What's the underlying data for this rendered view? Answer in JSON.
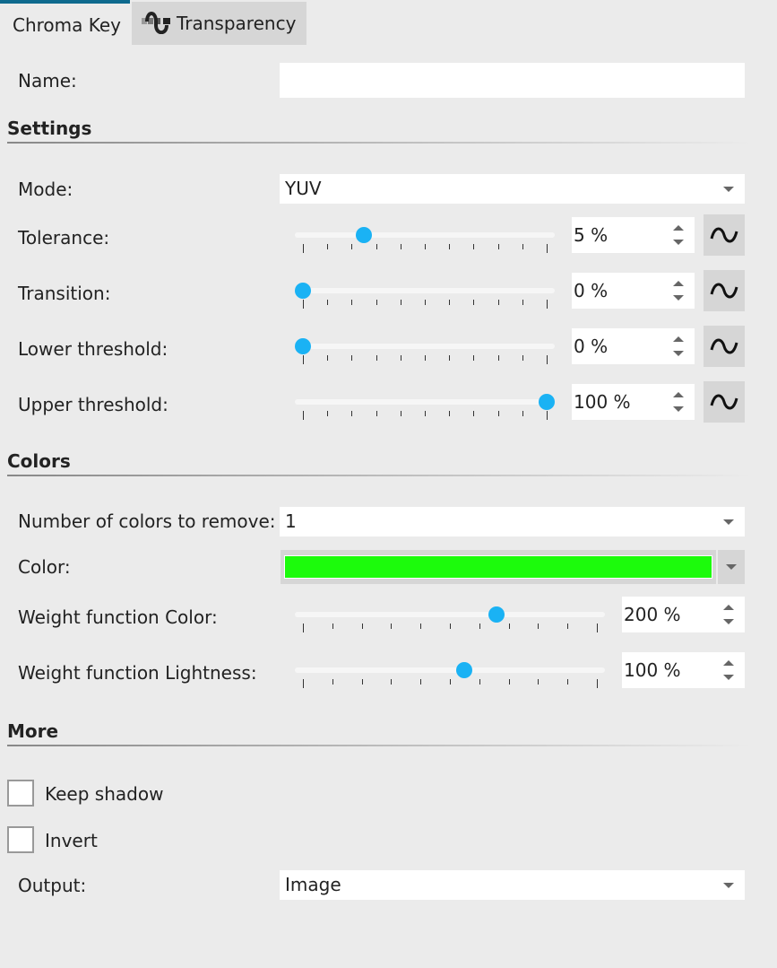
{
  "tabs": [
    {
      "label": "Chroma Key",
      "active": true
    },
    {
      "label": "Transparency",
      "active": false,
      "icon": "transparency-icon"
    }
  ],
  "name": {
    "label": "Name:",
    "value": ""
  },
  "sections": {
    "settings": "Settings",
    "colors": "Colors",
    "more": "More"
  },
  "settings": {
    "mode": {
      "label": "Mode:",
      "value": "YUV"
    },
    "sliders": [
      {
        "label": "Tolerance:",
        "display": "5 %",
        "fraction": 0.25
      },
      {
        "label": "Transition:",
        "display": "0 %",
        "fraction": 0.0
      },
      {
        "label": "Lower threshold:",
        "display": "0 %",
        "fraction": 0.0
      },
      {
        "label": "Upper threshold:",
        "display": "100 %",
        "fraction": 1.0
      }
    ]
  },
  "colors": {
    "count": {
      "label": "Number of colors to remove:",
      "value": "1"
    },
    "color": {
      "label": "Color:",
      "swatch": "#1cfb0c"
    },
    "sliders": [
      {
        "label": "Weight function Color:",
        "display": "200 %",
        "fraction": 0.66
      },
      {
        "label": "Weight function Lightness:",
        "display": "100 %",
        "fraction": 0.55
      }
    ]
  },
  "more": {
    "keep_shadow": {
      "label": "Keep shadow",
      "checked": false
    },
    "invert": {
      "label": "Invert",
      "checked": false
    },
    "output": {
      "label": "Output:",
      "value": "Image"
    }
  },
  "accent": "#1ab2f4"
}
